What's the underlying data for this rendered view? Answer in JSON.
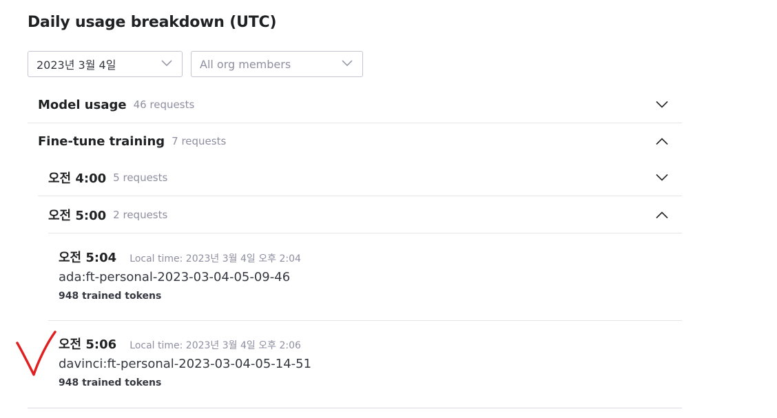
{
  "page_title": "Daily usage breakdown (UTC)",
  "filters": {
    "date_value": "2023년 3월 4일",
    "member_value": "All org members"
  },
  "sections": {
    "model_usage": {
      "label": "Model usage",
      "count": "46 requests",
      "expanded": false
    },
    "fine_tune": {
      "label": "Fine-tune training",
      "count": "7 requests",
      "expanded": true,
      "hours": [
        {
          "label": "오전 4:00",
          "count": "5 requests",
          "expanded": false
        },
        {
          "label": "오전 5:00",
          "count": "2 requests",
          "expanded": true
        }
      ],
      "jobs": [
        {
          "time": "오전 5:04",
          "local_time": "Local time: 2023년 3월 4일 오후 2:04",
          "model": "ada:ft-personal-2023-03-04-05-09-46",
          "tokens": "948 trained tokens"
        },
        {
          "time": "오전 5:06",
          "local_time": "Local time: 2023년 3월 4일 오후 2:06",
          "model": "davinci:ft-personal-2023-03-04-05-14-51",
          "tokens": "948 trained tokens"
        }
      ]
    }
  },
  "colors": {
    "text_primary": "#202123",
    "text_secondary": "#8e8ea0",
    "border": "#c5c5d2",
    "divider": "#e5e5e5",
    "annotation_mark": "#e02020"
  },
  "icons": {
    "collapsed": "chevron-down-icon",
    "expanded": "chevron-up-icon",
    "annotation": "red-checkmark-annotation"
  }
}
